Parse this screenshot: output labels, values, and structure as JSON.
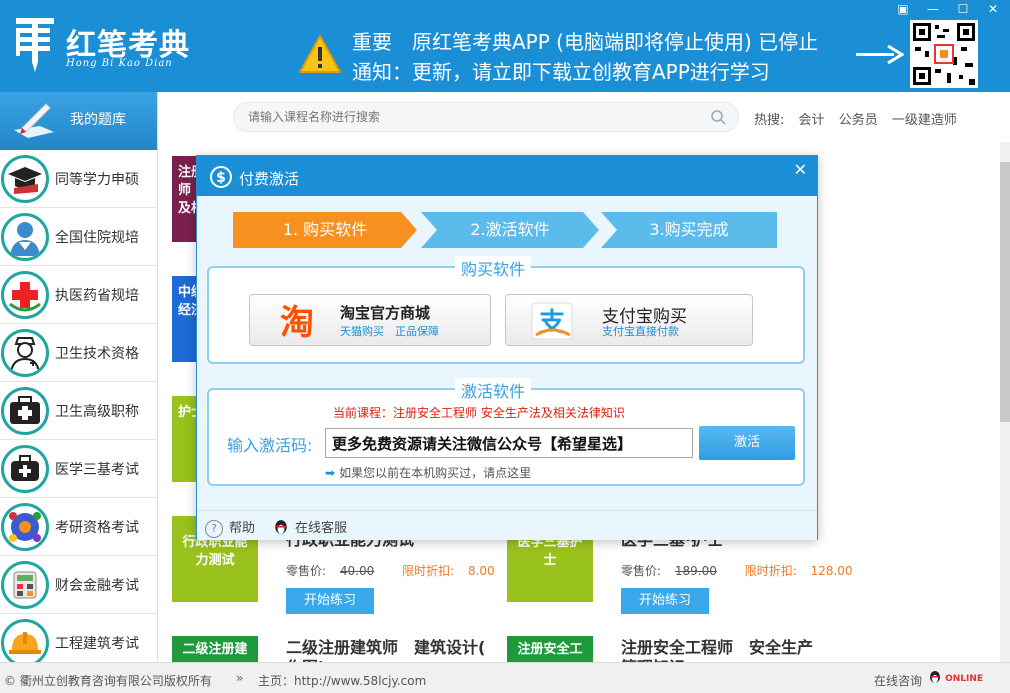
{
  "header": {
    "logo_cn": "红笔考典",
    "logo_en": "Hong Bi Kao Dian",
    "notice_line1": "重要　原红笔考典APP (电脑端即将停止使用) 已停止",
    "notice_line2": "通知：更新，请立即下载立创教育APP进行学习",
    "window_controls": [
      "▣",
      "—",
      "☐",
      "✕"
    ]
  },
  "sidebar": {
    "head_label": "我的题库",
    "items": [
      {
        "label": "同等学力申硕",
        "icon": "graduation-cap-icon"
      },
      {
        "label": "全国住院规培",
        "icon": "doctor-icon"
      },
      {
        "label": "执医药省规培",
        "icon": "red-cross-icon"
      },
      {
        "label": "卫生技术资格",
        "icon": "nurse-icon"
      },
      {
        "label": "卫生高级职称",
        "icon": "medical-kit-icon"
      },
      {
        "label": "医学三基考试",
        "icon": "first-aid-icon"
      },
      {
        "label": "考研资格考试",
        "icon": "people-icon"
      },
      {
        "label": "财会金融考试",
        "icon": "calculator-icon"
      },
      {
        "label": "工程建筑考试",
        "icon": "hard-hat-icon"
      }
    ]
  },
  "search": {
    "placeholder": "请输入课程名称进行搜索",
    "hot_label": "热搜:",
    "hot_items": [
      "会计",
      "公务员",
      "一级建造师"
    ]
  },
  "content": {
    "cards_partial": [
      {
        "thumb": "注册\n师 安\n及相",
        "color": "#7a1f4e"
      },
      {
        "thumb": "中级\n经济",
        "color": "#1e6ad6"
      },
      {
        "thumb": "护士",
        "color": "#9ac21c"
      }
    ],
    "row_cards": [
      {
        "thumb": "行政职业能力测试",
        "color": "#9ac21c",
        "title": "行政职业能力测试",
        "price_label": "零售价:",
        "price": "40.00",
        "discount_label": "限时折扣:",
        "discount": "8.00",
        "button": "开始练习"
      },
      {
        "thumb": "医学三基护士",
        "color": "#9ac21c",
        "title": "医学三基·护士",
        "price_label": "零售价:",
        "price": "189.00",
        "discount_label": "限时折扣:",
        "discount": "128.00",
        "button": "开始练习"
      }
    ],
    "bottom_cards": [
      {
        "thumb": "二级注册建",
        "color": "#1e9a3c",
        "title": "二级注册建筑师　建筑设计(",
        "title2": "作图)"
      },
      {
        "thumb": "注册安全工",
        "color": "#1e9a3c",
        "title": "注册安全工程师　安全生产",
        "title2": "管理知识"
      }
    ]
  },
  "footer": {
    "copyright": "© 衢州立创教育咨询有限公司版权所有",
    "sep": "»",
    "home": "主页：http://www.58lcjy.com",
    "consult": "在线咨询",
    "online": "ONLINE"
  },
  "modal": {
    "title": "付费激活",
    "close": "✕",
    "steps": [
      "1. 购买软件",
      "2.激活软件",
      "3.购买完成"
    ],
    "step_colors": {
      "active": "#f7901e",
      "inactive": "#5bbcec"
    },
    "buy_legend": "购买软件",
    "taobao_main": "淘宝官方商城",
    "taobao_sub": "天猫购买　正品保障",
    "alipay_main": "支付宝购买",
    "alipay_sub": "支付宝直接付款",
    "activate_legend": "激活软件",
    "course": "当前课程：注册安全工程师 安全生产法及相关法律知识",
    "code_label": "输入激活码:",
    "code_value": "更多免费资源请关注微信公众号【希望星选】",
    "activate_button": "激活",
    "bought_link": "如果您以前在本机购买过，请点这里",
    "help": "帮助",
    "customer_service": "在线客服"
  }
}
